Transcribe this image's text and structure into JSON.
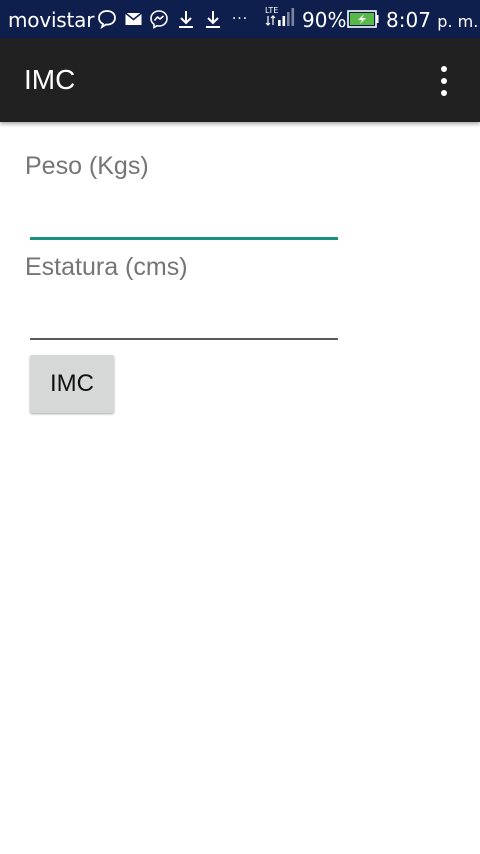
{
  "status_bar": {
    "carrier": "movistar",
    "network": "LTE",
    "battery_percent": "90%",
    "time": "8:07",
    "ampm": "p. m.",
    "background": "#0f1f4d",
    "icons": [
      "chat-bubble-icon",
      "mail-icon",
      "messenger-icon",
      "download-icon",
      "download-icon",
      "more-notifications-icon",
      "signal-icon",
      "battery-charging-icon"
    ],
    "more_glyph": "···"
  },
  "app_bar": {
    "title": "IMC",
    "background": "#212121",
    "overflow_menu_icon": "more-vert-icon"
  },
  "form": {
    "weight_label": "Peso (Kgs)",
    "weight_value": "",
    "height_label": "Estatura (cms)",
    "height_value": "",
    "accent_color": "#18917f",
    "button_label": "IMC"
  }
}
